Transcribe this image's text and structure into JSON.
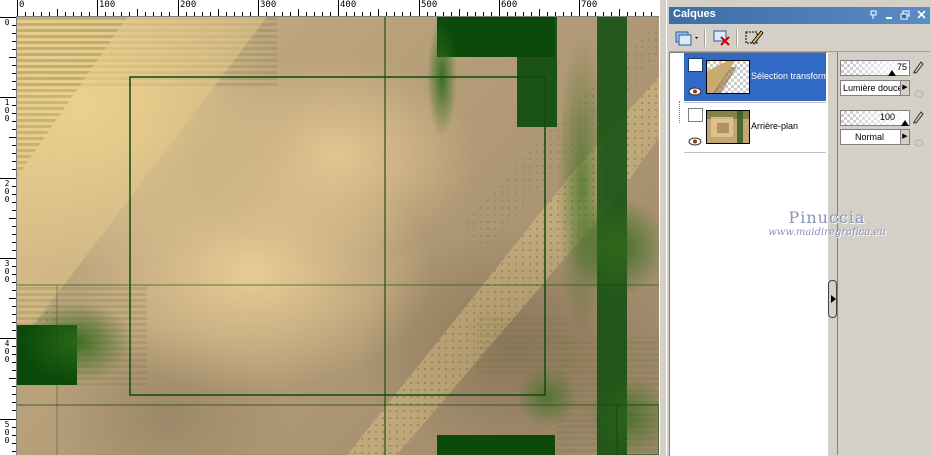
{
  "ruler": {
    "top_labels": [
      "0",
      "100",
      "200",
      "300",
      "400",
      "500",
      "600",
      "700"
    ],
    "left_labels": [
      "0",
      "100",
      "200",
      "300",
      "400",
      "500"
    ]
  },
  "palette": {
    "title": "Calques",
    "title_buttons": [
      "pin-icon",
      "close-icon",
      "restore-icon",
      "close-icon"
    ],
    "tools": [
      "new-layer-icon",
      "delete-layer-icon",
      "edit-selection-icon"
    ],
    "layers": [
      {
        "name": "Sélection transformée",
        "selected": true,
        "opacity": 75,
        "blend_mode": "Lumière douce",
        "visible": true
      },
      {
        "name": "Arrière-plan",
        "selected": false,
        "opacity": 100,
        "blend_mode": "Normal",
        "visible": true
      }
    ]
  },
  "watermark": {
    "name": "Pinuccia",
    "url": "www.maidiregrafica.eu"
  },
  "colors": {
    "selection": "#316ac5",
    "titlebar": "#3a6ea5",
    "art_green": "#0e4d0e",
    "art_tan": "#c8b088"
  }
}
